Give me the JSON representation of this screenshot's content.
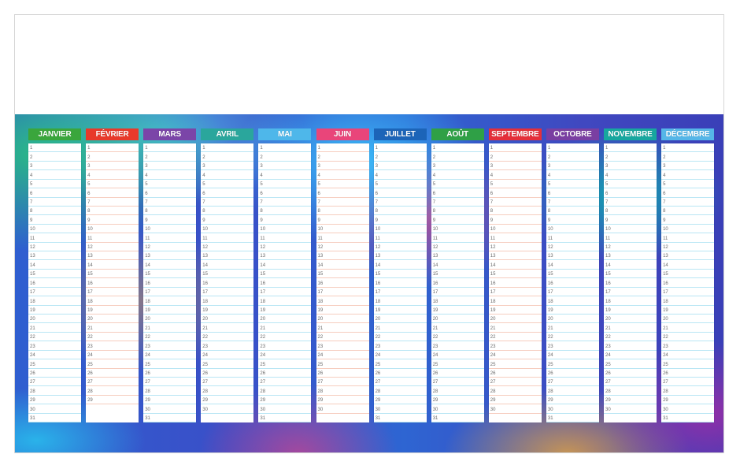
{
  "calendar": {
    "months": [
      {
        "name": "JANVIER",
        "days": 31,
        "color": "#3aa63c",
        "line": "#b9e6f4"
      },
      {
        "name": "FÉVRIER",
        "days": 29,
        "color": "#e8392a",
        "line": "#f6cdbf"
      },
      {
        "name": "MARS",
        "days": 31,
        "color": "#7b45a8",
        "line": "#b9e6f4"
      },
      {
        "name": "AVRIL",
        "days": 30,
        "color": "#2aa69c",
        "line": "#b9e6f4"
      },
      {
        "name": "MAI",
        "days": 31,
        "color": "#4eb7ea",
        "line": "#b9e6f4"
      },
      {
        "name": "JUIN",
        "days": 30,
        "color": "#e9457a",
        "line": "#f6cdbf"
      },
      {
        "name": "JUILLET",
        "days": 31,
        "color": "#1c64b8",
        "line": "#b9e6f4"
      },
      {
        "name": "AOÛT",
        "days": 31,
        "color": "#2fa046",
        "line": "#b9e6f4"
      },
      {
        "name": "SEPTEMBRE",
        "days": 30,
        "color": "#e52f3a",
        "line": "#f6cdbf"
      },
      {
        "name": "OCTOBRE",
        "days": 31,
        "color": "#7a3fa2",
        "line": "#b9e6f4"
      },
      {
        "name": "NOVEMBRE",
        "days": 30,
        "color": "#17a79f",
        "line": "#b9e6f4"
      },
      {
        "name": "DÉCEMBRE",
        "days": 31,
        "color": "#55b6e8",
        "line": "#b9e6f4"
      }
    ]
  }
}
